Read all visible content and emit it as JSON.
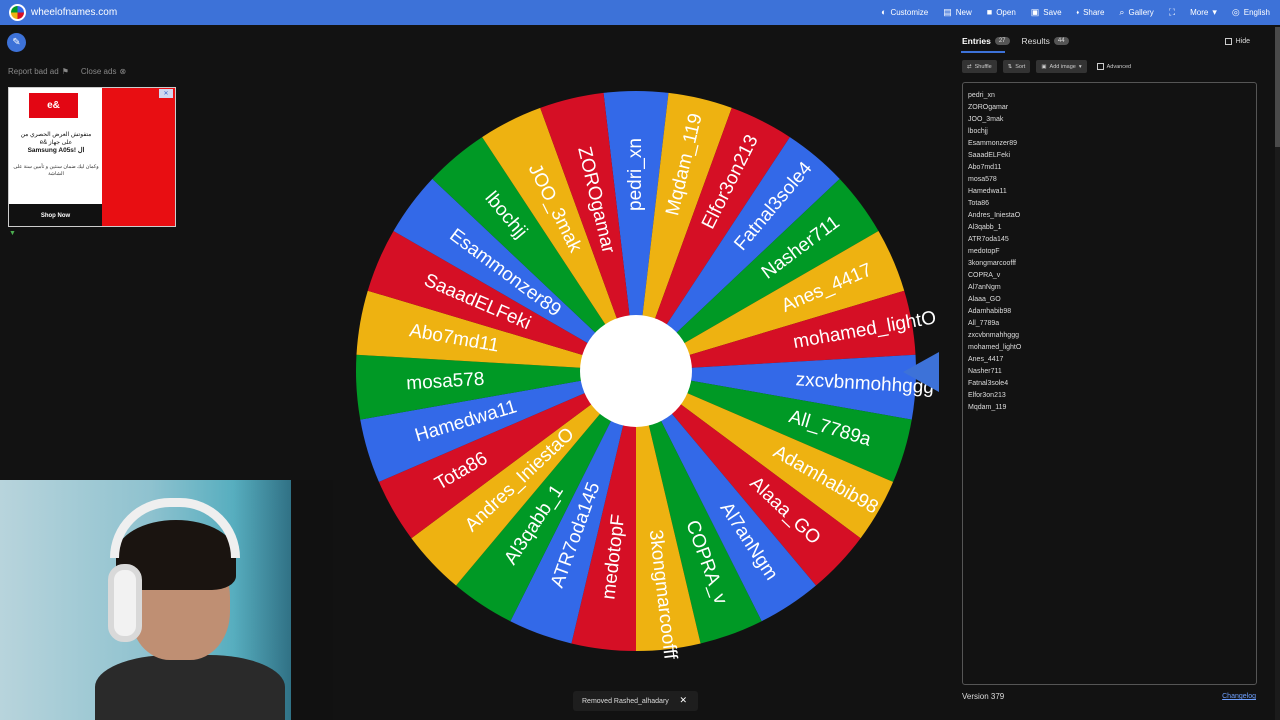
{
  "header": {
    "site_title": "wheelofnames.com",
    "nav": [
      {
        "label": "Customize",
        "icon": "palette-icon",
        "glyph": "◐"
      },
      {
        "label": "New",
        "icon": "file-icon",
        "glyph": "▤"
      },
      {
        "label": "Open",
        "icon": "folder-icon",
        "glyph": "■"
      },
      {
        "label": "Save",
        "icon": "save-icon",
        "glyph": "▣"
      },
      {
        "label": "Share",
        "icon": "share-icon",
        "glyph": "⬪"
      },
      {
        "label": "Gallery",
        "icon": "search-icon",
        "glyph": "⌕"
      },
      {
        "label": "",
        "icon": "fullscreen-icon",
        "glyph": "⛶"
      },
      {
        "label": "More",
        "icon": "chevron-down-icon",
        "glyph": "▾"
      },
      {
        "label": "English",
        "icon": "globe-icon",
        "glyph": "◎"
      }
    ]
  },
  "ad_controls": {
    "report": "Report bad ad",
    "close": "Close ads"
  },
  "ad": {
    "brand": "e&",
    "line1": "متفوتش العرض الحصري من",
    "line2": "e& على جهاز",
    "line3": "Samsung A05s! ال",
    "small": "وكمان ليك ضمان سنتين و تأمين سنة على الشاشة",
    "cta": "Shop Now"
  },
  "wheel": {
    "slices": [
      "pedri_xn",
      "Mqdam_119",
      "Elfor3on213",
      "Fatnal3sole4",
      "Nasher711",
      "Anes_4417",
      "mohamed_lightO",
      "zxcvbnmohhggg",
      "All_7789a",
      "Adamhabib98",
      "Alaaa_GO",
      "Al7anNgm",
      "COPRA_v",
      "3kongmarcoofff",
      "medotopF",
      "ATR7oda145",
      "Al3qabb_1",
      "Andres_IniestaO",
      "Tota86",
      "Hamedwa11",
      "mosa578",
      "Abo7md11",
      "SaaadELFeki",
      "Esammonzer89",
      "lbochjj",
      "JOO_3mak",
      "ZOROgamar"
    ],
    "colors": [
      "#3369e8",
      "#eeb211",
      "#d50f25",
      "#3369e8",
      "#009925",
      "#eeb211",
      "#d50f25",
      "#3369e8",
      "#009925",
      "#eeb211",
      "#d50f25",
      "#3369e8",
      "#009925",
      "#eeb211",
      "#d50f25",
      "#3369e8",
      "#009925",
      "#eeb211",
      "#d50f25",
      "#3369e8",
      "#009925",
      "#eeb211",
      "#d50f25",
      "#3369e8",
      "#009925",
      "#eeb211",
      "#d50f25"
    ],
    "pointer_color": "#3d72d8"
  },
  "toast": {
    "message": "Removed Rashed_alhadary"
  },
  "panel": {
    "tab_entries": "Entries",
    "entries_count": "27",
    "tab_results": "Results",
    "results_count": "44",
    "hide": "Hide",
    "shuffle": "Shuffle",
    "sort": "Sort",
    "add_image": "Add image",
    "advanced": "Advanced",
    "entries": [
      "pedri_xn",
      "ZOROgamar",
      "JOO_3mak",
      "lbochjj",
      "Esammonzer89",
      "SaaadELFeki",
      "Abo7md11",
      "mosa578",
      "Hamedwa11",
      "Tota86",
      "Andres_IniestaO",
      "Al3qabb_1",
      "ATR7oda145",
      "medotopF",
      "3kongmarcoofff",
      "COPRA_v",
      "Al7anNgm",
      "Alaaa_GO",
      "Adamhabib98",
      "All_7789a",
      "zxcvbnmahhggg",
      "mohamed_lightO",
      "Anes_4417",
      "Nasher711",
      "Fatnal3sole4",
      "Elfor3on213",
      "Mqdam_119"
    ],
    "version": "Version 379",
    "changelog": "Changelog"
  },
  "colors": {
    "accent": "#3d72d8",
    "background": "#121212"
  }
}
